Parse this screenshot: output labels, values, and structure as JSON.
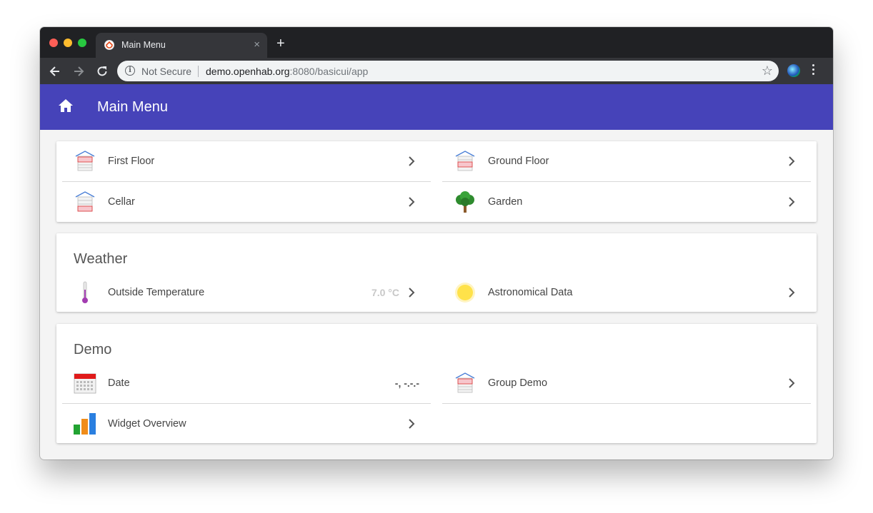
{
  "browser": {
    "tab_title": "Main Menu",
    "tab_close": "×",
    "new_tab": "+",
    "security_label": "Not Secure",
    "url_host": "demo.openhab.org",
    "url_rest": ":8080/basicui/app",
    "star": "☆"
  },
  "header": {
    "title": "Main Menu",
    "color": "#4643b9"
  },
  "main_menu": {
    "items": [
      {
        "label": "First Floor",
        "icon": "house-first-floor-icon"
      },
      {
        "label": "Ground Floor",
        "icon": "house-ground-floor-icon"
      },
      {
        "label": "Cellar",
        "icon": "house-cellar-icon"
      },
      {
        "label": "Garden",
        "icon": "tree-icon"
      }
    ]
  },
  "weather": {
    "title": "Weather",
    "items": [
      {
        "label": "Outside Temperature",
        "value": "7.0 °C",
        "icon": "thermometer-icon"
      },
      {
        "label": "Astronomical Data",
        "icon": "sun-icon"
      }
    ]
  },
  "demo": {
    "title": "Demo",
    "items": [
      {
        "label": "Date",
        "value": "-, -.-.-",
        "icon": "calendar-icon"
      },
      {
        "label": "Group Demo",
        "icon": "house-icon"
      },
      {
        "label": "Widget Overview",
        "icon": "bar-chart-icon"
      }
    ]
  }
}
